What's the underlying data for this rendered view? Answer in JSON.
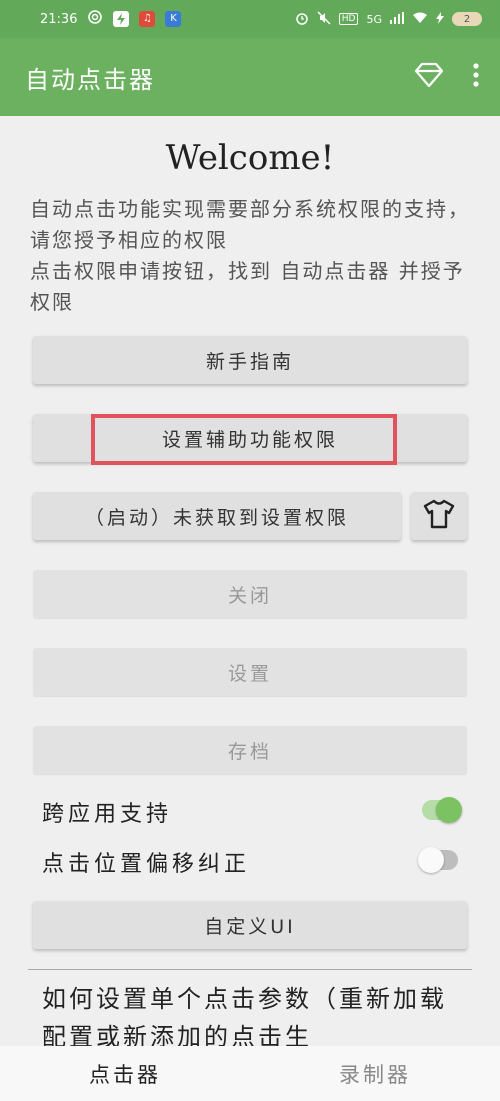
{
  "status_bar": {
    "time": "21:36",
    "battery": "2",
    "network": "5G",
    "hd": "HD"
  },
  "app_bar": {
    "title": "自动点击器"
  },
  "main": {
    "welcome": "Welcome!",
    "desc_line1": "自动点击功能实现需要部分系统权限的支持，请您授予相应的权限",
    "desc_line2": "点击权限申请按钮，找到 自动点击器 并授予权限",
    "buttons": {
      "guide": "新手指南",
      "accessibility": "设置辅助功能权限",
      "start": "（启动）未获取到设置权限",
      "close": "关闭",
      "settings": "设置",
      "archive": "存档",
      "custom_ui": "自定义UI"
    },
    "toggles": {
      "cross_app_label": "跨应用支持",
      "cross_app_on": true,
      "offset_label": "点击位置偏移纠正",
      "offset_on": false
    },
    "help_text": "如何设置单个点击参数（重新加载配置或新添加的点击生"
  },
  "bottom_nav": {
    "tab_clicker": "点击器",
    "tab_recorder": "录制器"
  },
  "colors": {
    "status_bar": "#62a95a",
    "app_bar": "#6bb160",
    "highlight": "#e0525e",
    "switch_on_knob": "#7cc263",
    "switch_on_track": "#b6dda7"
  }
}
